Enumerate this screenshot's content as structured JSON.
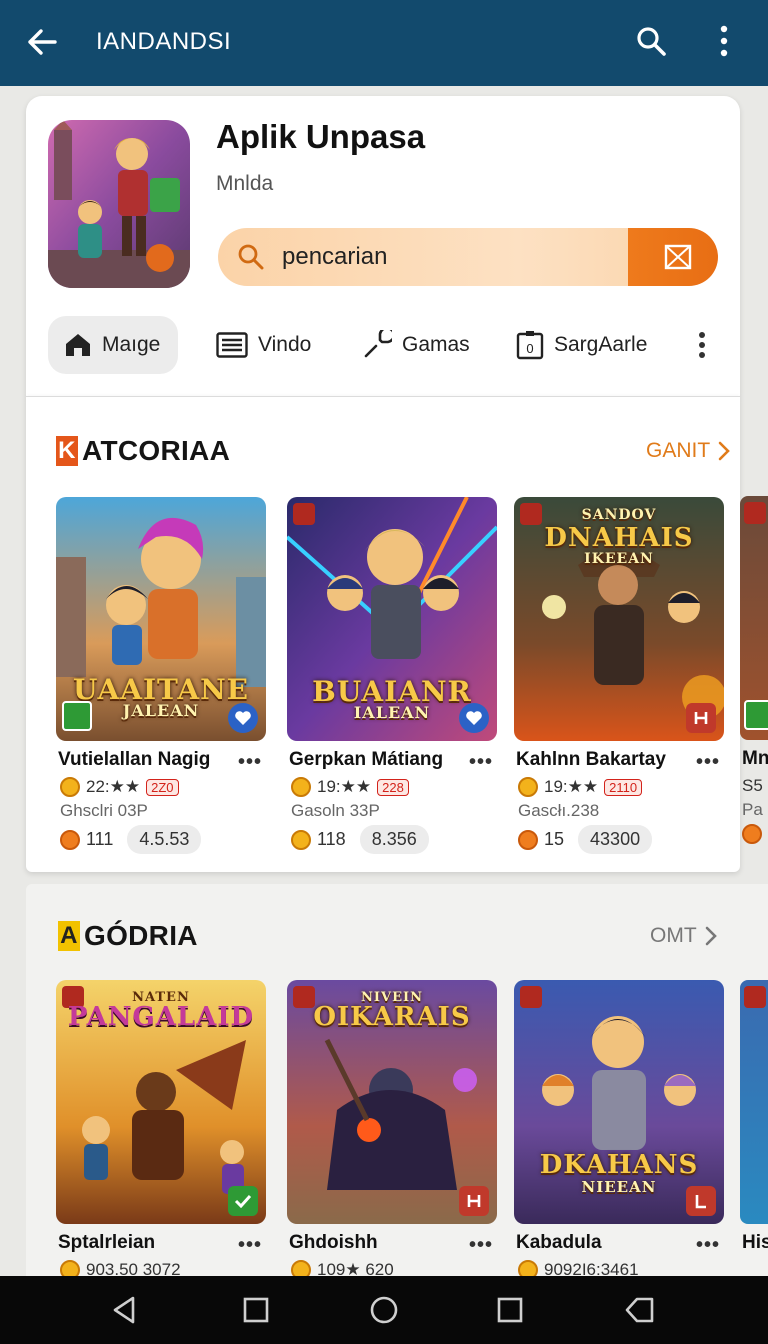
{
  "appbar": {
    "title": "IANDANDSI",
    "back_icon": "arrow-left-icon",
    "search_icon": "search-icon",
    "more_icon": "more-vertical-icon"
  },
  "header": {
    "app_name": "Aplik Unpasa",
    "app_sub": "Mnlda"
  },
  "search": {
    "text": "pencarian"
  },
  "chips": [
    {
      "label": "Maıge",
      "icon": "home-icon"
    },
    {
      "label": "Vindo",
      "icon": "list-icon"
    },
    {
      "label": "Gamas",
      "icon": "wrench-icon"
    },
    {
      "label": "SargAarle",
      "icon": "badge-icon"
    }
  ],
  "section1": {
    "mark": "K",
    "title": "ATCORIAA",
    "more": "GANIT",
    "games": [
      {
        "banner": "UAAITANE",
        "banner_sub": "JALEAN",
        "title": "Vutielallan Nagig",
        "rating": "22:★★",
        "tag": "2Z0",
        "sub": "Ghsclri 03P",
        "count": "111",
        "pill": "4.5.53"
      },
      {
        "banner": "BUAIANR",
        "banner_sub": "IALEAN",
        "title": "Gerpkan Mátiang",
        "rating": "19:★★",
        "tag": "228",
        "sub": "Gasoln 33P",
        "count": "118",
        "pill": "8.356"
      },
      {
        "banner": "DNAHAIS",
        "banner_sub": "IKEEAN",
        "banner_top": "SANDOV",
        "title": "Kahlnn Bakartay",
        "rating": "19:★★",
        "tag": "2110",
        "sub": "Gascłı.238",
        "count": "15",
        "pill": "43300"
      },
      {
        "title": "Mn",
        "rating": "S5",
        "sub": "Pa"
      }
    ]
  },
  "section2": {
    "mark": "A",
    "title": "GÓDRIA",
    "more": "OMT",
    "games": [
      {
        "banner": "PANGALAID",
        "banner_top": "NATEN",
        "title": "Sptalrleian",
        "sub": "903.50 3072"
      },
      {
        "banner": "OIKARAIS",
        "banner_top": "NIVEIN",
        "title": "Ghdoishh",
        "sub": "109★ 620"
      },
      {
        "banner": "DKAHANS",
        "banner_sub": "NIEEAN",
        "title": "Kabadula",
        "sub": "9092I6:3461"
      },
      {
        "title": "His"
      }
    ]
  },
  "nav": {
    "back": "nav-back-icon",
    "home": "nav-home-icon",
    "square1": "nav-square-icon",
    "square2": "nav-recents-icon",
    "tag": "nav-tag-icon"
  }
}
